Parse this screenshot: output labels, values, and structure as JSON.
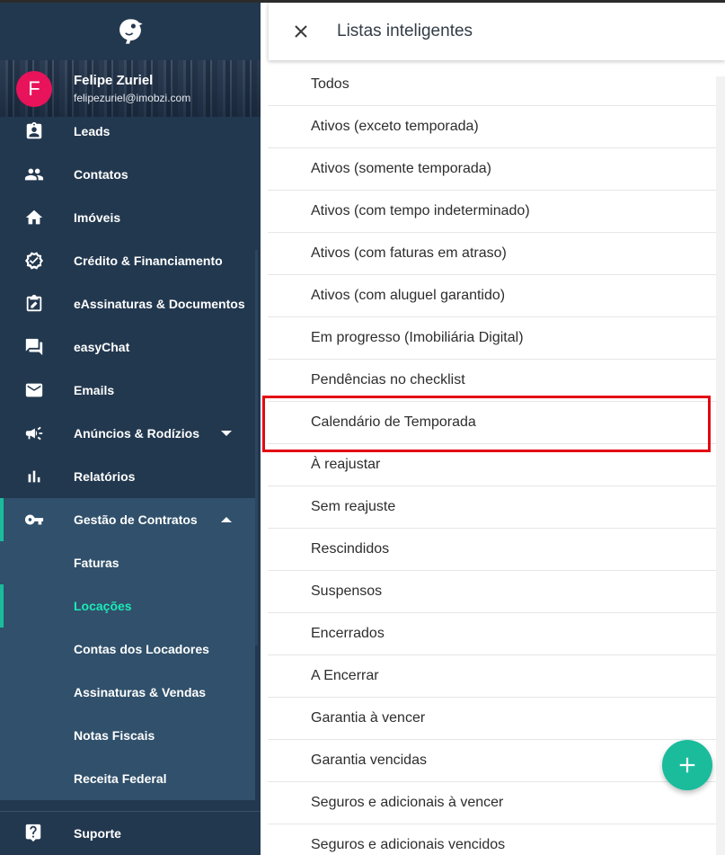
{
  "sidebar": {
    "user": {
      "initial": "F",
      "name": "Felipe Zuriel",
      "email": "felipezuriel@imobzi.com"
    },
    "nav": [
      {
        "label": "Leads",
        "icon": "contact-badge-icon"
      },
      {
        "label": "Contatos",
        "icon": "people-icon"
      },
      {
        "label": "Imóveis",
        "icon": "home-icon"
      },
      {
        "label": "Crédito & Financiamento",
        "icon": "verified-check-icon"
      },
      {
        "label": "eAssinaturas & Documentos",
        "icon": "signature-clipboard-icon"
      },
      {
        "label": "easyChat",
        "icon": "chat-icon"
      },
      {
        "label": "Emails",
        "icon": "mail-icon"
      },
      {
        "label": "Anúncios & Rodízios",
        "icon": "megaphone-icon"
      },
      {
        "label": "Relatórios",
        "icon": "bar-chart-icon"
      },
      {
        "label": "Gestão de Contratos",
        "icon": "key-icon"
      }
    ],
    "sub": [
      {
        "label": "Faturas"
      },
      {
        "label": "Locações"
      },
      {
        "label": "Contas dos Locadores"
      },
      {
        "label": "Assinaturas & Vendas"
      },
      {
        "label": "Notas Fiscais"
      },
      {
        "label": "Receita Federal"
      }
    ],
    "support": {
      "label": "Suporte",
      "icon": "help-icon"
    }
  },
  "panel": {
    "title": "Listas inteligentes",
    "items": [
      "Todos",
      "Ativos (exceto temporada)",
      "Ativos (somente temporada)",
      "Ativos (com tempo indeterminado)",
      "Ativos (com faturas em atraso)",
      "Ativos (com aluguel garantido)",
      "Em progresso (Imobiliária Digital)",
      "Pendências no checklist",
      "Calendário de Temporada",
      "À reajustar",
      "Sem reajuste",
      "Rescindidos",
      "Suspensos",
      "Encerrados",
      "A Encerrar",
      "Garantia à vencer",
      "Garantia vencidas",
      "Seguros e adicionais à vencer",
      "Seguros e adicionais vencidos"
    ]
  },
  "colors": {
    "sidebar": "#22384f",
    "accent": "#1abc9c",
    "highlight": "#e30613",
    "avatar": "#e8135a"
  }
}
